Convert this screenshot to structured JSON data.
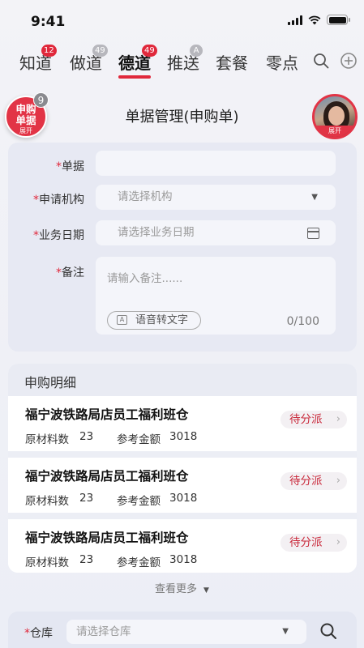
{
  "status_bar": {
    "time": "9:41"
  },
  "top_tabs": [
    {
      "label": "知道",
      "badge": "12",
      "badge_color": "#e0283b"
    },
    {
      "label": "做道",
      "badge": "49",
      "badge_color": "#b7b7bd"
    },
    {
      "label": "德道",
      "badge": "49",
      "badge_color": "#e0283b",
      "active": true
    },
    {
      "label": "推送",
      "badge": "A",
      "badge_color": "#b7b7bd"
    },
    {
      "label": "套餐",
      "badge": ""
    },
    {
      "label": "零点",
      "badge": ""
    }
  ],
  "tab_icons": [
    "search-icon",
    "add-circle-icon"
  ],
  "header": {
    "title": "单据管理(申购单)",
    "request_button": {
      "line1": "申购",
      "line2": "单据",
      "expand": "展开",
      "count": "9"
    },
    "avatar_expand": "展开"
  },
  "form": {
    "doc_label": "单据",
    "org_label": "申请机构",
    "org_placeholder": "请选择机构",
    "date_label": "业务日期",
    "date_placeholder": "请选择业务日期",
    "remark_label": "备注",
    "remark_placeholder": "请输入备注......",
    "voice_button": "语音转文字",
    "voice_icon_text": "A",
    "counter": "0/100",
    "required_mark": "*"
  },
  "detail": {
    "section_title": "申购明细",
    "items": [
      {
        "name": "福宁波铁路局店员工福利班仓",
        "qty_label": "原材料数",
        "qty": "23",
        "amount_label": "参考金额",
        "amount": "3018",
        "status": "待分派"
      },
      {
        "name": "福宁波铁路局店员工福利班仓",
        "qty_label": "原材料数",
        "qty": "23",
        "amount_label": "参考金额",
        "amount": "3018",
        "status": "待分派"
      },
      {
        "name": "福宁波铁路局店员工福利班仓",
        "qty_label": "原材料数",
        "qty": "23",
        "amount_label": "参考金额",
        "amount": "3018",
        "status": "待分派"
      }
    ],
    "more_label": "查看更多"
  },
  "warehouse": {
    "label": "仓库",
    "placeholder": "请选择仓库"
  },
  "colors": {
    "accent": "#e0283b",
    "status_text": "#c9283a"
  }
}
